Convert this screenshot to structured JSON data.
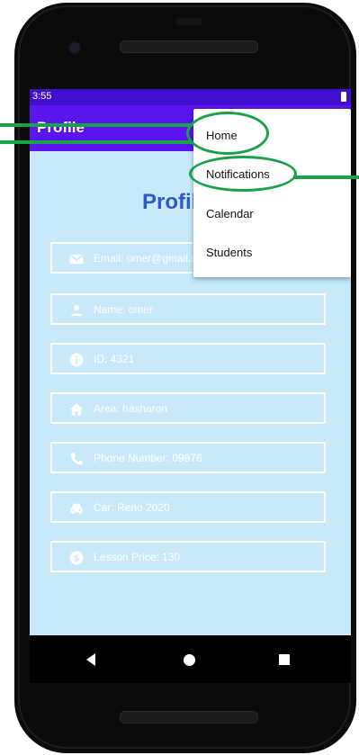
{
  "status_bar": {
    "time": "3:55"
  },
  "app_bar": {
    "title": "Profile"
  },
  "page": {
    "heading": "Profile"
  },
  "fields": [
    {
      "icon": "email-icon",
      "text": "Email: omer@gmail.com"
    },
    {
      "icon": "person-icon",
      "text": "Name: omer"
    },
    {
      "icon": "info-icon",
      "text": "ID: 4321"
    },
    {
      "icon": "home-icon",
      "text": "Area: hasharon"
    },
    {
      "icon": "phone-icon",
      "text": "Phone Number: 09876"
    },
    {
      "icon": "car-icon",
      "text": "Car: Reno 2020"
    },
    {
      "icon": "dollar-icon",
      "text": "Lesson Price: 130"
    }
  ],
  "menu": {
    "items": [
      "Home",
      "Notifications",
      "Calendar",
      "Students"
    ]
  },
  "colors": {
    "status_bar": "#3f0ecf",
    "app_bar": "#5a14ee",
    "screen_bg": "#c8e9fa",
    "heading": "#2f59c9",
    "annotation": "#16a34a"
  }
}
